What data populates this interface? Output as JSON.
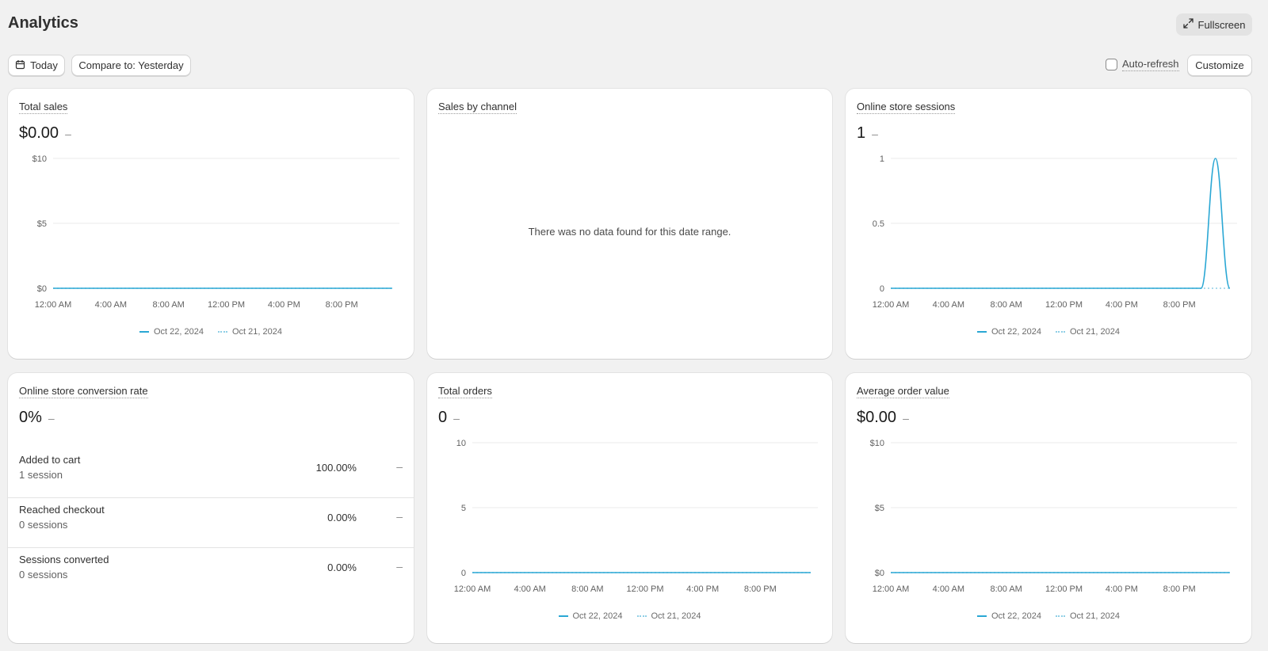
{
  "header": {
    "title": "Analytics",
    "fullscreen_label": "Fullscreen"
  },
  "toolbar": {
    "date_label": "Today",
    "compare_label": "Compare to: Yesterday",
    "autorefresh_label": "Auto-refresh",
    "autorefresh_checked": false,
    "customize_label": "Customize"
  },
  "colors": {
    "primary_series": "#2aa7d4",
    "comparison_series": "#8fcfe6"
  },
  "legend": {
    "current": "Oct 22, 2024",
    "previous": "Oct 21, 2024"
  },
  "x_ticks": [
    "12:00 AM",
    "4:00 AM",
    "8:00 AM",
    "12:00 PM",
    "4:00 PM",
    "8:00 PM"
  ],
  "cards": {
    "total_sales": {
      "title": "Total sales",
      "value": "$0.00",
      "change": "–"
    },
    "sales_by_channel": {
      "title": "Sales by channel",
      "empty_message": "There was no data found for this date range."
    },
    "sessions": {
      "title": "Online store sessions",
      "value": "1",
      "change": "–"
    },
    "conversion": {
      "title": "Online store conversion rate",
      "value": "0%",
      "change": "–",
      "rows": [
        {
          "label": "Added to cart",
          "sub": "1 session",
          "pct": "100.00%",
          "change": "–"
        },
        {
          "label": "Reached checkout",
          "sub": "0 sessions",
          "pct": "0.00%",
          "change": "–"
        },
        {
          "label": "Sessions converted",
          "sub": "0 sessions",
          "pct": "0.00%",
          "change": "–"
        }
      ]
    },
    "total_orders": {
      "title": "Total orders",
      "value": "0",
      "change": "–"
    },
    "aov": {
      "title": "Average order value",
      "value": "$0.00",
      "change": "–"
    }
  },
  "chart_data": [
    {
      "type": "line",
      "title": "Total sales",
      "x_ticks": [
        "12:00 AM",
        "4:00 AM",
        "8:00 AM",
        "12:00 PM",
        "4:00 PM",
        "8:00 PM"
      ],
      "y_ticks": [
        "$0",
        "$5",
        "$10"
      ],
      "ylim": [
        0,
        10
      ],
      "series": [
        {
          "name": "Oct 22, 2024",
          "x": [
            0,
            23.5
          ],
          "y": [
            0,
            0
          ]
        },
        {
          "name": "Oct 21, 2024",
          "x": [
            0,
            23.5
          ],
          "y": [
            0,
            0
          ]
        }
      ]
    },
    {
      "type": "line",
      "title": "Online store sessions",
      "x_ticks": [
        "12:00 AM",
        "4:00 AM",
        "8:00 AM",
        "12:00 PM",
        "4:00 PM",
        "8:00 PM"
      ],
      "y_ticks": [
        "0",
        "0.5",
        "1"
      ],
      "ylim": [
        0,
        1
      ],
      "series": [
        {
          "name": "Oct 22, 2024",
          "x": [
            0,
            21.5,
            22,
            22.5,
            23,
            23.5
          ],
          "y": [
            0,
            0,
            0.6,
            1,
            0.6,
            0
          ]
        },
        {
          "name": "Oct 21, 2024",
          "x": [
            0,
            23.5
          ],
          "y": [
            0,
            0
          ]
        }
      ]
    },
    {
      "type": "line",
      "title": "Total orders",
      "x_ticks": [
        "12:00 AM",
        "4:00 AM",
        "8:00 AM",
        "12:00 PM",
        "4:00 PM",
        "8:00 PM"
      ],
      "y_ticks": [
        "0",
        "5",
        "10"
      ],
      "ylim": [
        0,
        10
      ],
      "series": [
        {
          "name": "Oct 22, 2024",
          "x": [
            0,
            23.5
          ],
          "y": [
            0,
            0
          ]
        },
        {
          "name": "Oct 21, 2024",
          "x": [
            0,
            23.5
          ],
          "y": [
            0,
            0
          ]
        }
      ]
    },
    {
      "type": "line",
      "title": "Average order value",
      "x_ticks": [
        "12:00 AM",
        "4:00 AM",
        "8:00 AM",
        "12:00 PM",
        "4:00 PM",
        "8:00 PM"
      ],
      "y_ticks": [
        "$0",
        "$5",
        "$10"
      ],
      "ylim": [
        0,
        10
      ],
      "series": [
        {
          "name": "Oct 22, 2024",
          "x": [
            0,
            23.5
          ],
          "y": [
            0,
            0
          ]
        },
        {
          "name": "Oct 21, 2024",
          "x": [
            0,
            23.5
          ],
          "y": [
            0,
            0
          ]
        }
      ]
    }
  ]
}
